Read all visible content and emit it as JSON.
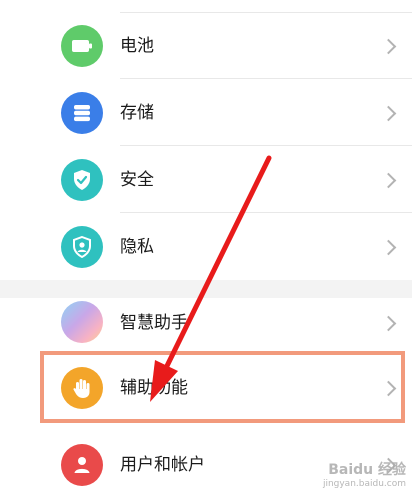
{
  "settings_items": [
    {
      "label": "电池",
      "icon": "battery-icon",
      "color": "#5fcb6a"
    },
    {
      "label": "存储",
      "icon": "storage-icon",
      "color": "#3a7ee8"
    },
    {
      "label": "安全",
      "icon": "shield-check-icon",
      "color": "#2fc1bf"
    },
    {
      "label": "隐私",
      "icon": "privacy-shield-icon",
      "color": "#2fc1bf"
    },
    {
      "label": "智慧助手",
      "icon": "smart-assistant-icon",
      "color": "#c9a7e8"
    },
    {
      "label": "辅助功能",
      "icon": "hand-icon",
      "color": "#f3a52a"
    },
    {
      "label": "用户和帐户",
      "icon": "user-icon",
      "color": "#e94a4a"
    }
  ],
  "annotation": {
    "arrow_color": "#e81b1b",
    "highlight_color": "#f29a7c"
  },
  "watermark": {
    "brand": "Baidu 经验",
    "sub": "jingyan.baidu.com"
  }
}
